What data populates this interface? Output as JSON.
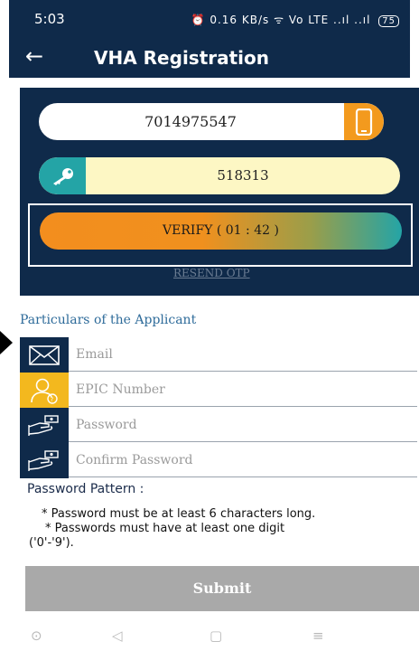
{
  "status_bar": {
    "time": "5:03",
    "icons_text": "⏰ 0.16 KB/s ᯤ Vo LTE ..ıl ..ıl",
    "battery": "75"
  },
  "app_bar": {
    "title": "VHA Registration",
    "back_icon": "arrow-left-icon"
  },
  "verification": {
    "mobile_number": "7014975547",
    "otp": "518313",
    "verify_label": "VERIFY ( 01 : 42 )",
    "resend_label": "RESEND OTP"
  },
  "form": {
    "section_title": "Particulars of the Applicant",
    "fields": {
      "email_placeholder": "Email",
      "epic_placeholder": "EPIC Number",
      "password_placeholder": "Password",
      "confirm_placeholder": "Confirm Password"
    }
  },
  "password_pattern": {
    "title": "Password Pattern :",
    "rule1": "* Password must be at least 6 characters long.",
    "rule2_line1": "* Passwords must have at least one digit",
    "rule2_line2": "('0'-'9')."
  },
  "submit_label": "Submit",
  "colors": {
    "navy": "#0f2a4a",
    "orange": "#f39a1e",
    "teal": "#24a4a6",
    "icon_yellow": "#f3b81e",
    "submit_gray": "#a9a9a9"
  }
}
